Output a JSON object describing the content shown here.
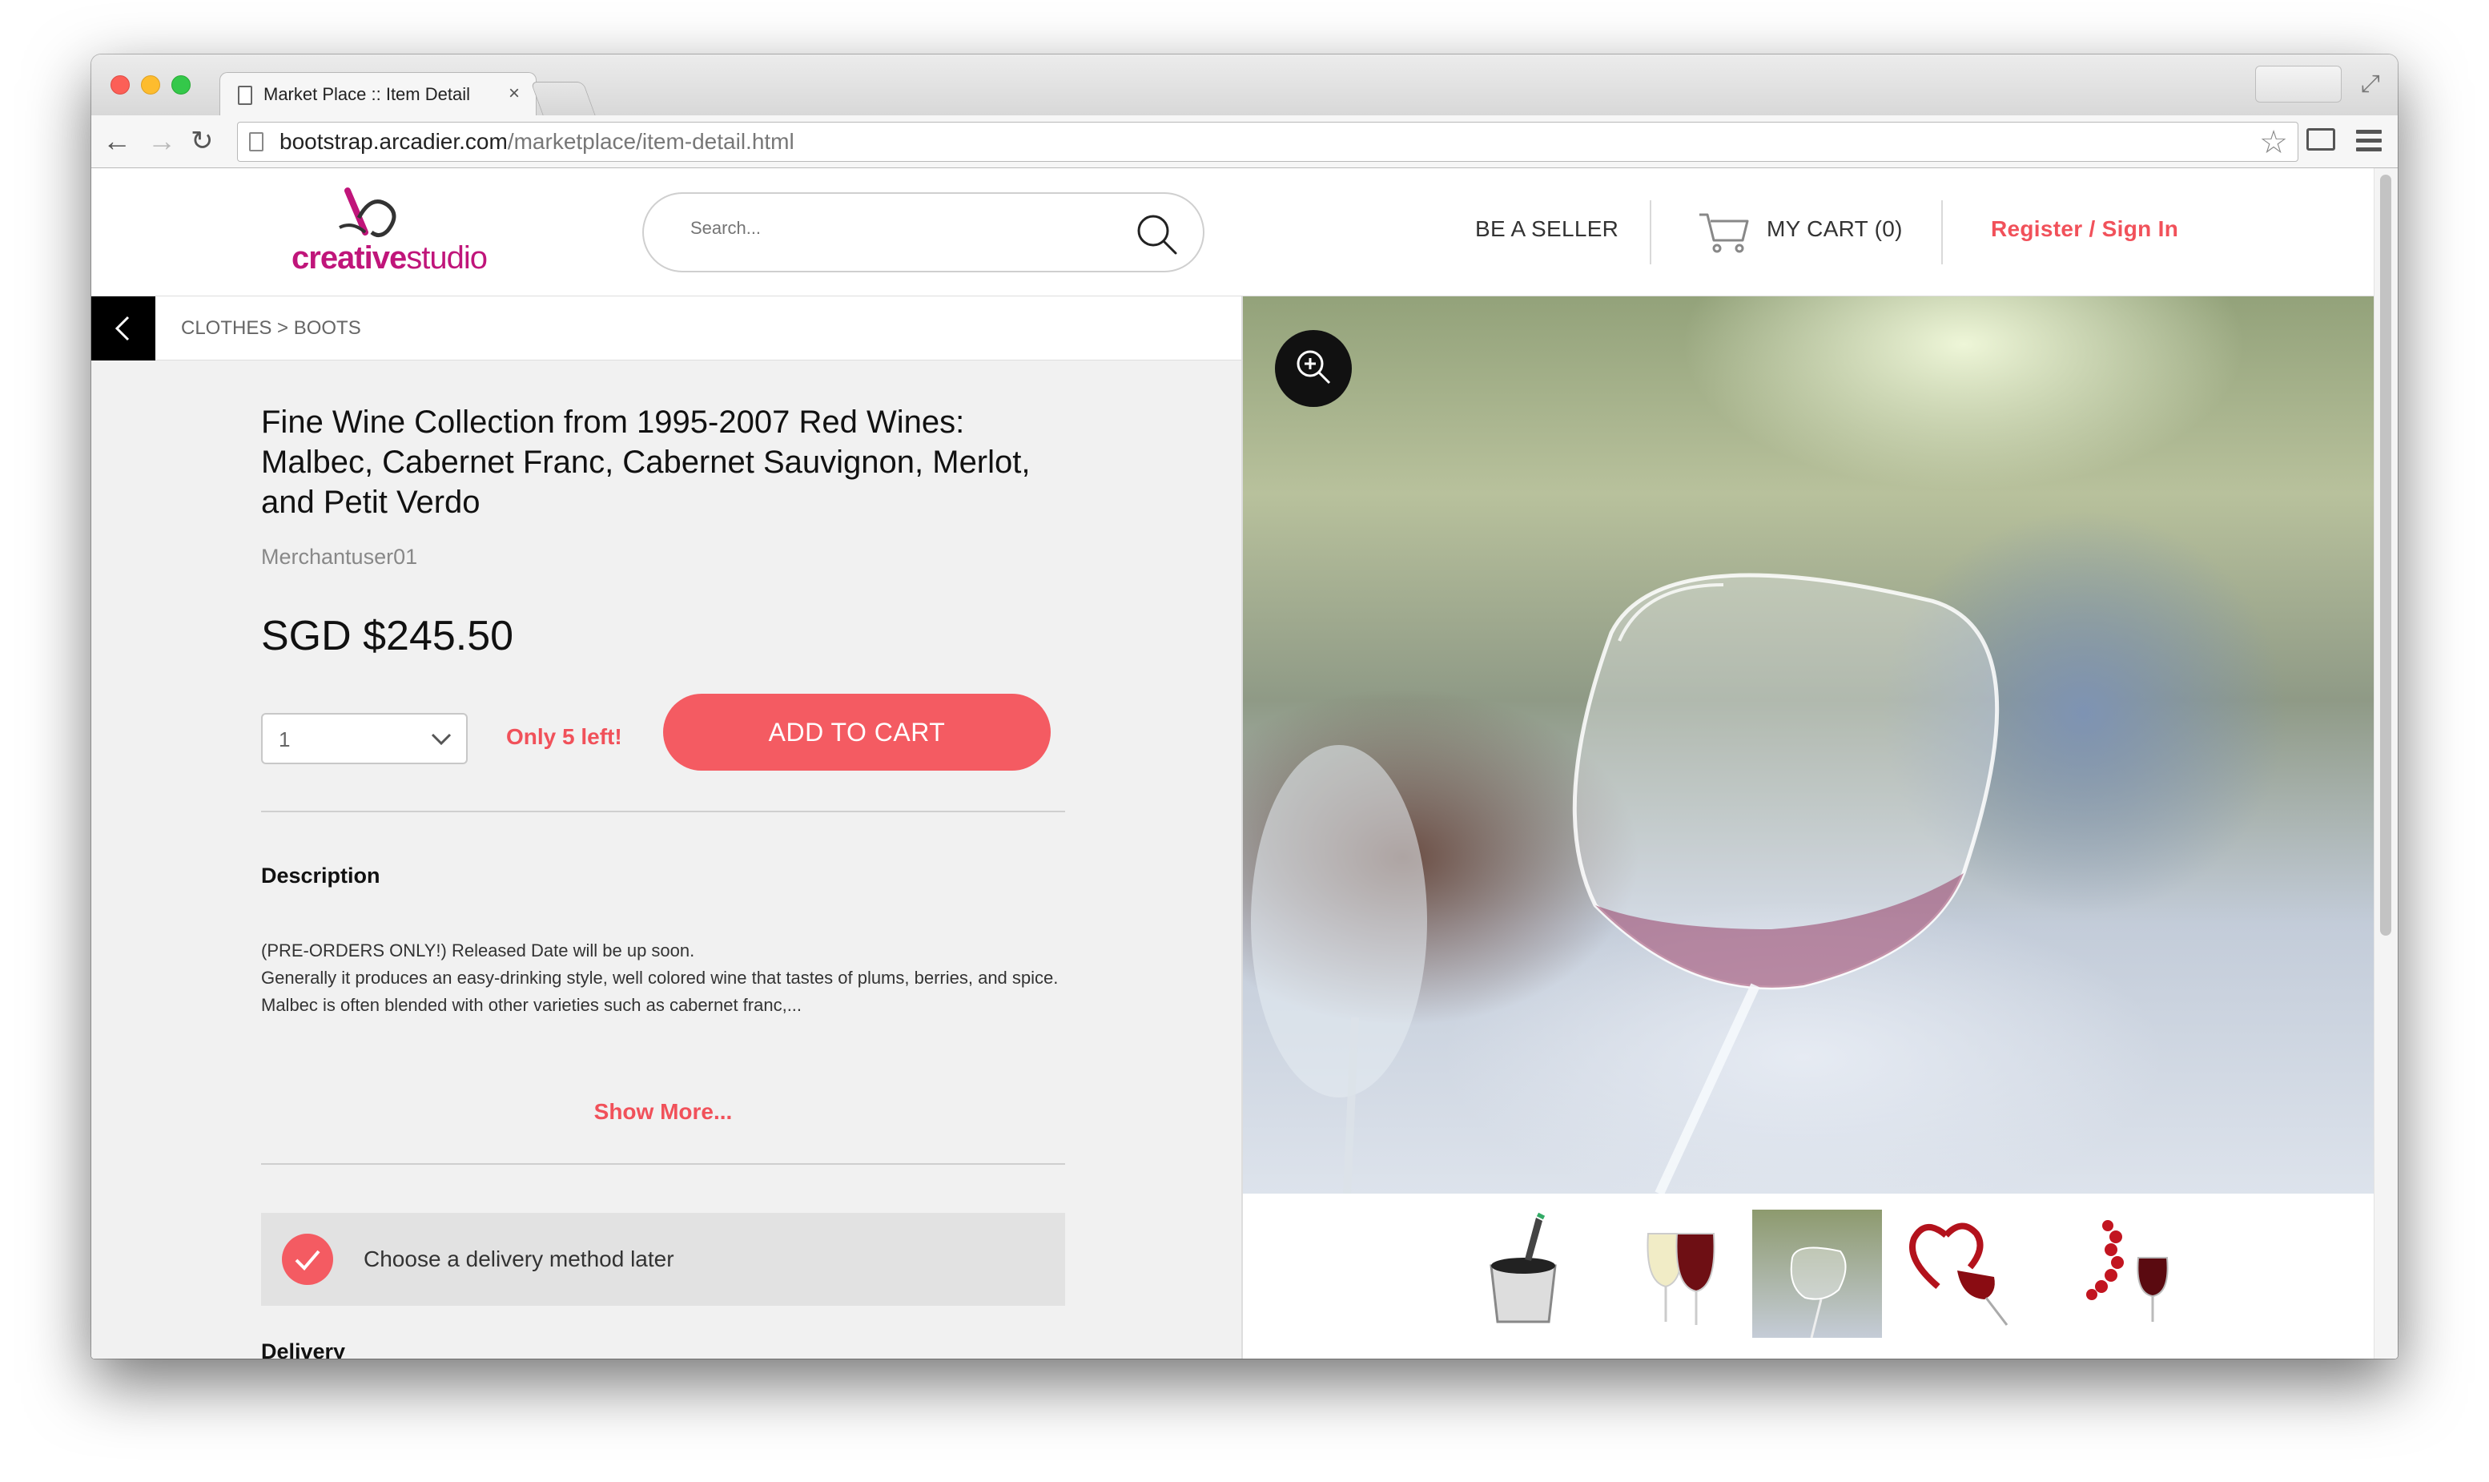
{
  "browser": {
    "tab_title": "Market Place :: Item Detail",
    "tab_close": "×",
    "url_host": "bootstrap.arcadier.com",
    "url_path": "/marketplace/item-detail.html"
  },
  "header": {
    "logo_part1": "creative",
    "logo_part2": "studio",
    "search_placeholder": "Search...",
    "be_seller": "BE A SELLER",
    "cart": "MY CART (0)",
    "register": "Register / Sign In"
  },
  "breadcrumb": "CLOTHES > BOOTS",
  "product": {
    "title": "Fine Wine Collection from 1995-2007 Red Wines: Malbec, Cabernet Franc, Cabernet Sauvignon, Merlot, and Petit Verdo",
    "merchant": "Merchantuser01",
    "price": "SGD $245.50",
    "quantity": "1",
    "stock": "Only 5 left!",
    "add_to_cart": "ADD TO CART",
    "description_heading": "Description",
    "description_line1": "(PRE-ORDERS ONLY!) Released Date will be up soon.",
    "description_line2": "Generally it produces an easy-drinking style, well colored wine that tastes of plums, berries, and spice. Malbec is often blended with other varieties such as cabernet franc,...",
    "show_more": "Show More...",
    "delivery_option": "Choose a delivery method later",
    "delivery_heading": "Delivery"
  },
  "colors": {
    "accent": "#f45b62",
    "brand": "#c0157a"
  },
  "icons": [
    "page-icon",
    "back-arrow-icon",
    "forward-arrow-icon",
    "reload-icon",
    "star-icon",
    "cast-icon",
    "menu-icon",
    "search-icon",
    "cart-icon",
    "chevron-left-icon",
    "chevron-down-icon",
    "check-icon",
    "zoom-in-icon"
  ]
}
